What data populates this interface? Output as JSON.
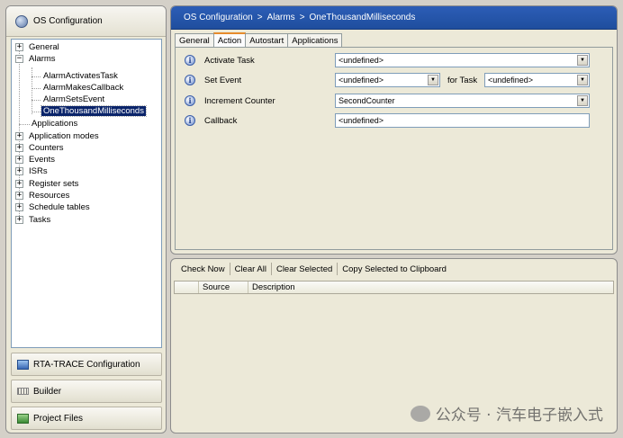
{
  "left_panel": {
    "header_label": "OS Configuration",
    "tree": [
      {
        "label": "General",
        "expander": "+",
        "selected": false
      },
      {
        "label": "Alarms",
        "expander": "−",
        "selected": false
      },
      {
        "label": "AlarmActivatesTask",
        "expander": "",
        "selected": false
      },
      {
        "label": "AlarmMakesCallback",
        "expander": "",
        "selected": false
      },
      {
        "label": "AlarmSetsEvent",
        "expander": "",
        "selected": false
      },
      {
        "label": "OneThousandMilliseconds",
        "expander": "",
        "selected": true
      },
      {
        "label": "Applications",
        "expander": "",
        "selected": false
      },
      {
        "label": "Application modes",
        "expander": "+",
        "selected": false
      },
      {
        "label": "Counters",
        "expander": "+",
        "selected": false
      },
      {
        "label": "Events",
        "expander": "+",
        "selected": false
      },
      {
        "label": "ISRs",
        "expander": "+",
        "selected": false
      },
      {
        "label": "Register sets",
        "expander": "+",
        "selected": false
      },
      {
        "label": "Resources",
        "expander": "+",
        "selected": false
      },
      {
        "label": "Schedule tables",
        "expander": "+",
        "selected": false
      },
      {
        "label": "Tasks",
        "expander": "+",
        "selected": false
      }
    ],
    "nav_buttons": [
      {
        "label": "RTA-TRACE Configuration",
        "icon": "trace-icon"
      },
      {
        "label": "Builder",
        "icon": "builder-icon"
      },
      {
        "label": "Project Files",
        "icon": "project-files-icon"
      }
    ]
  },
  "breadcrumb": [
    "OS Configuration",
    "Alarms",
    "OneThousandMilliseconds"
  ],
  "breadcrumb_separator": ">",
  "tabs": [
    {
      "label": "General",
      "active": false
    },
    {
      "label": "Action",
      "active": true
    },
    {
      "label": "Autostart",
      "active": false
    },
    {
      "label": "Applications",
      "active": false
    }
  ],
  "properties": {
    "activate_task": {
      "label": "Activate Task",
      "value": "<undefined>"
    },
    "set_event": {
      "label": "Set Event",
      "value": "<undefined>",
      "for_task_label": "for Task",
      "for_task_value": "<undefined>"
    },
    "increment_counter": {
      "label": "Increment Counter",
      "value": "SecondCounter"
    },
    "callback": {
      "label": "Callback",
      "value": "<undefined>"
    }
  },
  "toolbar": {
    "check_now": "Check Now",
    "clear_all": "Clear All",
    "clear_selected": "Clear Selected",
    "copy_selected": "Copy Selected to Clipboard"
  },
  "grid": {
    "columns": [
      "",
      "Source",
      "Description"
    ]
  },
  "watermark": "公众号 · 汽车电子嵌入式",
  "colors": {
    "breadcrumb_bg": "#2c5db6",
    "selection_bg": "#0a246a",
    "active_tab_accent": "#e68b2c"
  }
}
